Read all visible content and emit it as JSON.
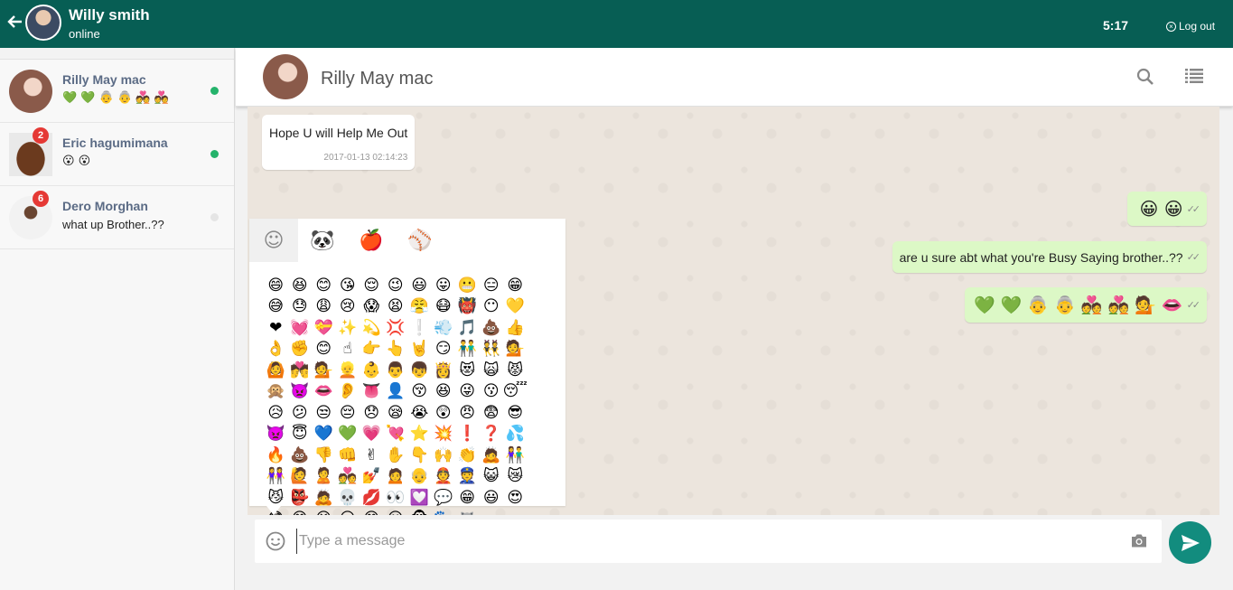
{
  "header": {
    "user_name": "Willy smith",
    "user_status": "online",
    "time": "5:17",
    "logout_label": "Log out"
  },
  "contacts": [
    {
      "name": "Rilly May mac",
      "preview": "💚 💚 👵 👵 💑 💑",
      "badge": "",
      "online": true,
      "dot_color": "#25b36b"
    },
    {
      "name": "Eric hagumimana",
      "preview": "😮 😮",
      "badge": "2",
      "online": true,
      "dot_color": "#25b36b"
    },
    {
      "name": "Dero Morghan",
      "preview": "what up Brother..??",
      "badge": "6",
      "online": false,
      "dot_color": "#e5e5e5"
    }
  ],
  "chat": {
    "title": "Rilly May mac",
    "messages": [
      {
        "direction": "in",
        "text": "Hope U will Help Me Out",
        "time": "2017-01-13 02:14:23"
      },
      {
        "direction": "out",
        "text": "😀 😀"
      },
      {
        "direction": "out",
        "text": "are u sure abt what you're Busy Saying brother..??"
      },
      {
        "direction": "out",
        "text": "💚 💚 👵 👵 💑 💑 💁 👄"
      }
    ]
  },
  "emoji_picker": {
    "tabs": [
      "smiley",
      "panda",
      "apple",
      "ball"
    ],
    "tab_glyphs": [
      "☺",
      "🐼",
      "🍎",
      "⚾"
    ],
    "active_tab": "smiley",
    "emojis": [
      "😄",
      "😆",
      "😊",
      "😘",
      "😌",
      "😉",
      "😃",
      "😛",
      "😬",
      "😑",
      "😁",
      "😅",
      "😓",
      "😩",
      "😢",
      "😱",
      "😫",
      "😤",
      "😷",
      "👹",
      "😶",
      "💛",
      "❤",
      "💓",
      "💝",
      "✨",
      "💫",
      "💢",
      "❕",
      "💨",
      "🎵",
      "💩",
      "👍",
      "👌",
      "✊",
      "😊",
      "☝",
      "👉",
      "👆",
      "🤘",
      "😏",
      "👬",
      "👯",
      "💁",
      "🙆",
      "💏",
      "💁",
      "👱",
      "👶",
      "👨",
      "👦",
      "👸",
      "😻",
      "🙀",
      "😾",
      "🙊",
      "👿",
      "👄",
      "👂",
      "👅",
      "👤",
      "😚",
      "😆",
      "😜",
      "😗",
      "😴",
      "😥",
      "😕",
      "😒",
      "😔",
      "😞",
      "😪",
      "😭",
      "😲",
      "😠",
      "😨",
      "😎",
      "👿",
      "😇",
      "💙",
      "💚",
      "💗",
      "💘",
      "⭐",
      "💥",
      "❗",
      "❓",
      "💦",
      "🔥",
      "💩",
      "👎",
      "👊",
      "✌",
      "✋",
      "👇",
      "🙌",
      "👏",
      "🙇",
      "👫",
      "👭",
      "🙋",
      "🙎",
      "💑",
      "💅",
      "🙍",
      "👴",
      "👲",
      "👮",
      "😺",
      "😿",
      "😼",
      "👺",
      "🙇",
      "💀",
      "💋",
      "👀",
      "💟",
      "💬",
      "😁",
      "😃",
      "😍",
      "😳",
      "😄",
      "😝",
      "😒",
      "😙",
      "😮",
      "🐵",
      "🐾",
      "🦝"
    ]
  },
  "input": {
    "placeholder": "Type a message"
  },
  "colors": {
    "primary": "#075e54",
    "accent": "#128c7e",
    "outgoing_bubble": "#dcf8c6",
    "badge": "#e53935"
  }
}
